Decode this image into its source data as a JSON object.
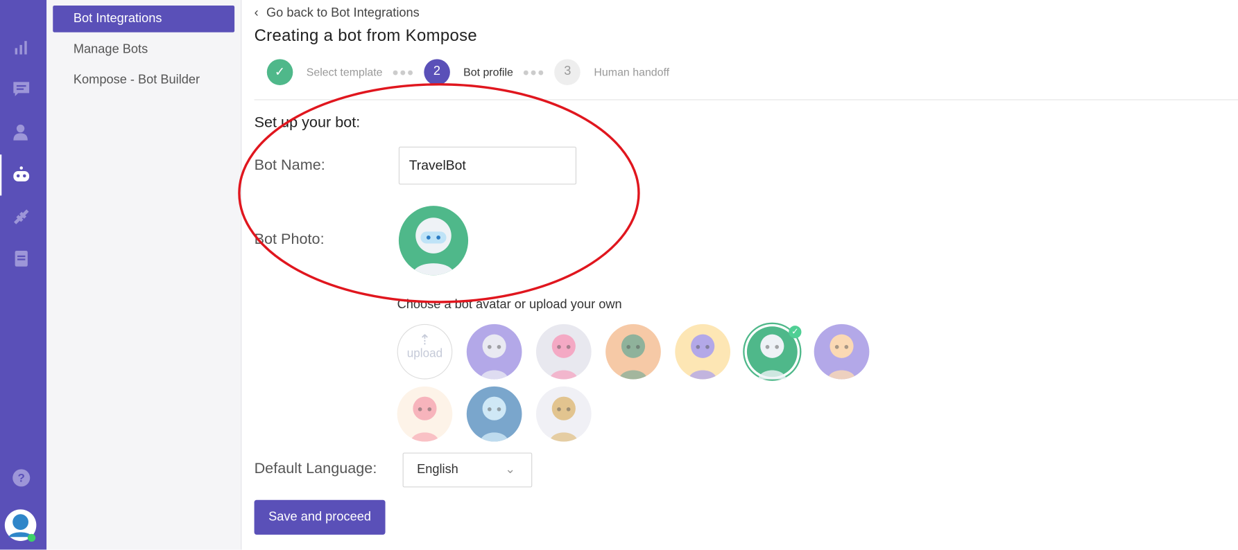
{
  "rail": {
    "icons": [
      "bar-chart-icon",
      "chat-icon",
      "users-icon",
      "bot-icon",
      "integrations-icon",
      "document-icon",
      "help-icon",
      "user-avatar"
    ],
    "accent": "#5a50b8"
  },
  "submenu": {
    "items": [
      {
        "label": "Bot Integrations",
        "selected": true
      },
      {
        "label": "Manage Bots"
      },
      {
        "label": "Kompose - Bot Builder"
      }
    ]
  },
  "header": {
    "back_link": "Go back to Bot Integrations",
    "title": "Creating a bot from Kompose"
  },
  "steps": [
    {
      "label": "Select template",
      "state": "done"
    },
    {
      "number": "2",
      "label": "Bot profile",
      "state": "active"
    },
    {
      "number": "3",
      "label": "Human handoff",
      "state": "pending"
    }
  ],
  "form": {
    "heading": "Set up your bot:",
    "bot_name_label": "Bot Name:",
    "bot_name_value": "TravelBot",
    "bot_photo_label": "Bot Photo:",
    "avatar_hint": "Choose a bot avatar or upload your own",
    "upload_label": "upload",
    "avatars": [
      {
        "bg": "#b3a8e8",
        "face": "#e9e9f2"
      },
      {
        "bg": "#e8e8ef",
        "face": "#f4a9c4"
      },
      {
        "bg": "#f6c9a6",
        "face": "#8fb29b"
      },
      {
        "bg": "#fde6b4",
        "face": "#b3a8e8"
      },
      {
        "bg": "#4fb88a",
        "face": "#eef2f6",
        "selected": true
      },
      {
        "bg": "#b3a8e8",
        "face": "#fbd9b4"
      },
      {
        "bg": "#fdf3e8",
        "face": "#f7b4bc"
      },
      {
        "bg": "#7aa6cc",
        "face": "#cfe8f6"
      },
      {
        "bg": "#f0f0f5",
        "face": "#e2c48f"
      }
    ],
    "language_label": "Default Language:",
    "language_value": "English",
    "save_label": "Save and proceed"
  },
  "annotation_color": "#e0161e"
}
